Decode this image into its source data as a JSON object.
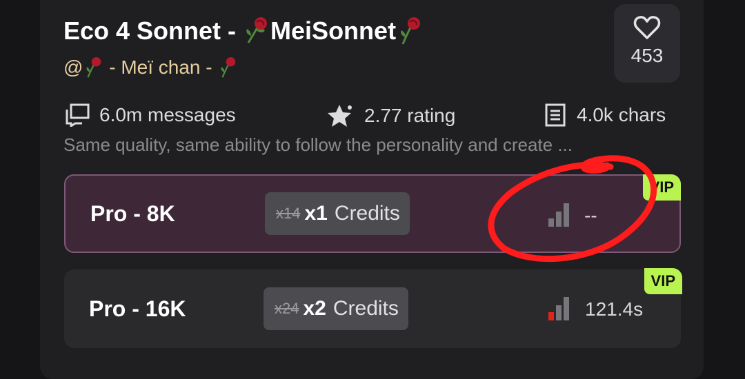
{
  "bot": {
    "title_prefix": "Eco 4 Sonnet - ",
    "title_name": "MeiSonnet",
    "author_prefix": "@",
    "author_name": " - Meï chan - ",
    "likes": "453"
  },
  "stats": {
    "messages": "6.0m messages",
    "rating": "2.77 rating",
    "chars": "4.0k chars"
  },
  "description": "Same quality, same ability to follow the personality and create ...",
  "models": [
    {
      "name": "Pro - 8K",
      "old_price": "x14",
      "multiplier": "x1",
      "unit": "Credits",
      "latency": "--",
      "badge": "VIP",
      "selected": true
    },
    {
      "name": "Pro - 16K",
      "old_price": "x24",
      "multiplier": "x2",
      "unit": "Credits",
      "latency": "121.4s",
      "badge": "VIP",
      "selected": false
    }
  ],
  "colors": {
    "vip_badge": "#b9f34f",
    "author": "#e7cfa0",
    "selected_border": "#7d5878",
    "latency_low": "#e0241b",
    "annotation": "#ff1c1c"
  },
  "icons": [
    "rose-icon",
    "heart-icon",
    "chat-icon",
    "star-icon",
    "document-icon",
    "signal-bars-icon"
  ]
}
